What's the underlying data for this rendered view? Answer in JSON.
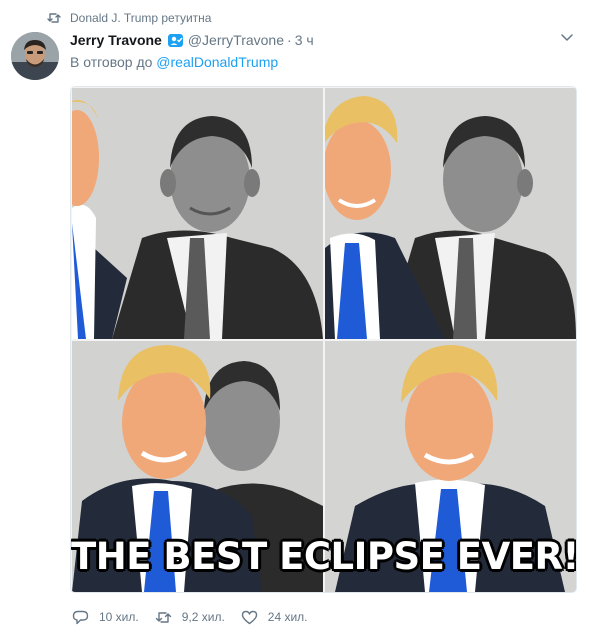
{
  "retweet": {
    "icon": "retweet-icon",
    "text": "Donald J. Trump ретуитна"
  },
  "author": {
    "avatar": "user-avatar",
    "name": "Jerry Travone",
    "verified_icon": "verified-badge-icon",
    "handle": "@JerryTravone",
    "separator": "·",
    "time": "3 ч"
  },
  "reply": {
    "prefix": "В отговор до",
    "mention": "@realDonaldTrump"
  },
  "media": {
    "panels": [
      "photo-panel-1",
      "photo-panel-2",
      "photo-panel-3",
      "photo-panel-4"
    ],
    "caption": "THE BEST ECLIPSE EVER!"
  },
  "actions": {
    "reply_count": "10 хил.",
    "retweet_count": "9,2 хил.",
    "like_count": "24 хил."
  },
  "colors": {
    "accent": "#1da1f2",
    "muted": "#657786",
    "text": "#14171a",
    "tie": "#1f5bd6",
    "suit": "#1c2230"
  }
}
